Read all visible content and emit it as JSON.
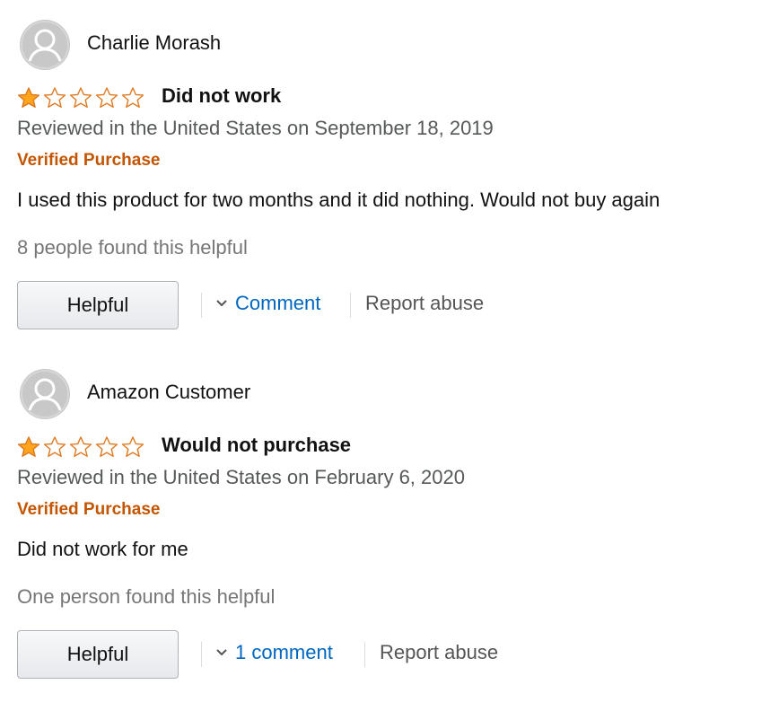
{
  "colors": {
    "star_fill": "#ffa41c",
    "star_outline": "#de7921",
    "verified": "#c45500",
    "link": "#0066c0",
    "muted_text": "#767676"
  },
  "reviews": [
    {
      "reviewer": "Charlie Morash",
      "avatar_icon": "default-user-avatar-icon",
      "rating": 1,
      "max_rating": 5,
      "title": "Did not work",
      "date_line": "Reviewed in the United States on September 18, 2019",
      "verified_label": "Verified Purchase",
      "body": "I used this product for two months and it did nothing. Would not buy again",
      "helpful_count_text": "8 people found this helpful",
      "helpful_button": "Helpful",
      "comment_label": "Comment",
      "report_label": "Report abuse"
    },
    {
      "reviewer": "Amazon Customer",
      "avatar_icon": "default-user-avatar-icon",
      "rating": 1,
      "max_rating": 5,
      "title": "Would not purchase",
      "date_line": "Reviewed in the United States on February 6, 2020",
      "verified_label": "Verified Purchase",
      "body": "Did not work for me",
      "helpful_count_text": "One person found this helpful",
      "helpful_button": "Helpful",
      "comment_label": "1 comment",
      "report_label": "Report abuse"
    }
  ]
}
